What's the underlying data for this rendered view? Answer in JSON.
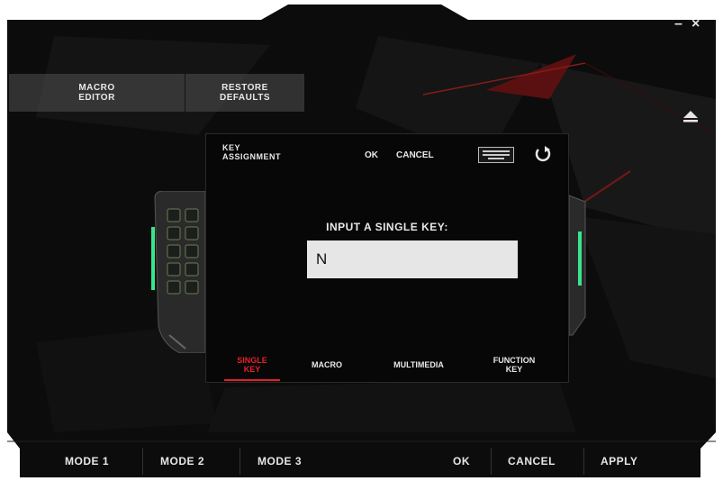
{
  "window": {
    "minimize": "–",
    "close": "×"
  },
  "top_bar": {
    "macro_editor": "MACRO\nEDITOR",
    "restore_defaults": "RESTORE\nDEFAULTS"
  },
  "dialog": {
    "title": "KEY\nASSIGNMENT",
    "ok": "OK",
    "cancel": "CANCEL",
    "prompt": "INPUT A SINGLE KEY:",
    "input_value": "N",
    "tabs": [
      {
        "label": "SINGLE\nKEY",
        "active": true
      },
      {
        "label": "MACRO",
        "active": false
      },
      {
        "label": "MULTIMEDIA",
        "active": false
      },
      {
        "label": "FUNCTION\nKEY",
        "active": false
      }
    ]
  },
  "bottom_bar": {
    "mode1": "MODE 1",
    "mode2": "MODE 2",
    "mode3": "MODE 3",
    "ok": "OK",
    "cancel": "CANCEL",
    "apply": "APPLY"
  },
  "colors": {
    "accent": "#e3202a",
    "led": "#39e58c",
    "background": "#0a0a0a"
  }
}
